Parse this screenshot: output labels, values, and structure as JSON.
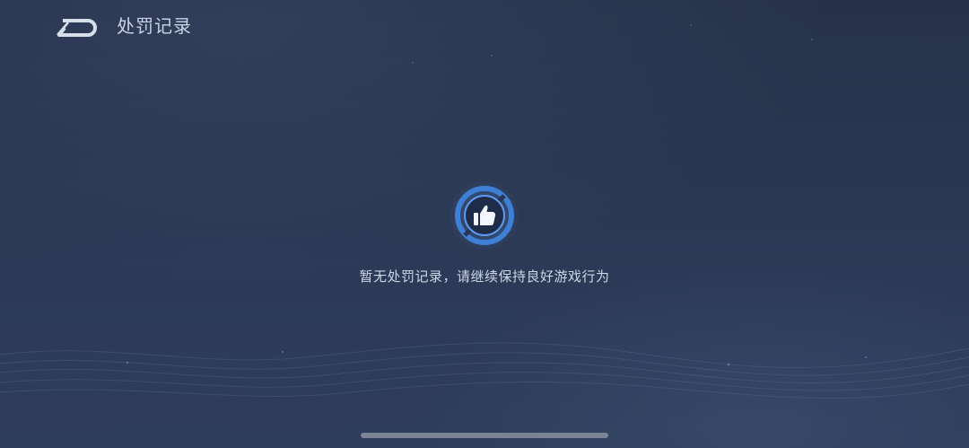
{
  "header": {
    "title": "处罚记录",
    "back_icon": "back-arrow-icon"
  },
  "empty_state": {
    "icon": "thumbs-up-icon",
    "message": "暂无处罚记录，请继续保持良好游戏行为"
  },
  "colors": {
    "background": "#2a3650",
    "title_text": "#c9d3e6",
    "accent": "#4a86d8",
    "home_indicator": "#7b8496"
  }
}
